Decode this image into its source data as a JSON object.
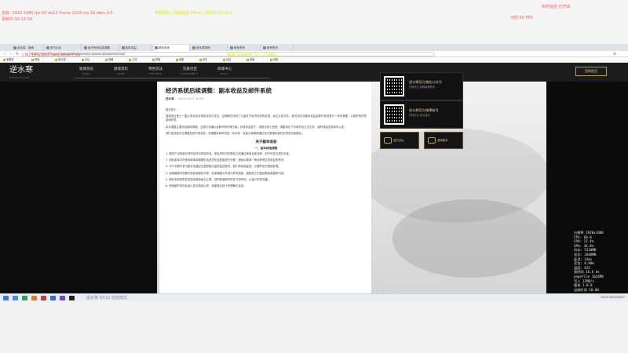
{
  "overlay_top": {
    "line1": "坐标: 1920 1080 fps 60 dx12 frame 1024 ms 16 data 0.0",
    "line2": "卡顿检测 | 网络延迟 24ms | 帧时间 16.6ms",
    "line3": "录制中 00:12:34",
    "line4": "CPU 12% GPU 34% MEM 5.2G",
    "line5": "缓存 2048MB  写入 12MB/s",
    "right1": "实时监控 已开启",
    "right2": "当前 60 FPS"
  },
  "browser": {
    "tabs": [
      {
        "title": "逆水寒 - 新闻"
      },
      {
        "title": "官方论坛"
      },
      {
        "title": "经济系统后续调整"
      },
      {
        "title": "副本收益"
      },
      {
        "title": "邮件系统"
      },
      {
        "title": "逆水寒官网"
      },
      {
        "title": "新标签页"
      },
      {
        "title": "新标签页"
      }
    ],
    "url": "https://nsh.163.com/news/update/economy-system-adjustment.html",
    "bookmarks": [
      "收藏夹",
      "网易",
      "逆水寒",
      "论坛",
      "攻略",
      "工具",
      "视频",
      "地图",
      "资讯",
      "社区",
      "商城",
      "设置"
    ]
  },
  "site": {
    "logo_text": "逆水寒",
    "logo_sub": "NISHUIHAN",
    "nav": [
      {
        "zh": "新闻资讯",
        "en": "NEWS"
      },
      {
        "zh": "游戏资料",
        "en": "GAME"
      },
      {
        "zh": "特色玩法",
        "en": "FEATURE"
      },
      {
        "zh": "玩家社区",
        "en": "COMMUNITY"
      },
      {
        "zh": "商城中心",
        "en": "MALL"
      }
    ],
    "official_button": "官网首页"
  },
  "article": {
    "title": "经济系统后续调整：副本收益及邮件系统",
    "author": "逆水寒",
    "date": "2023-10-27 10:00",
    "paragraphs": [
      "各位侠士：",
      "感谢各位侠士一直以来对逆水寒的支持与关注。近期我们收到了大量关于经济系统的反馈，经过认真讨论，我们决定对副本收益及邮件系统进行一系列调整，以维护良好的游戏环境。",
      "本次调整主要涉及副本掉落、交易行流通以及邮件附件等方面，具体内容如下，请各位侠士知悉。调整将在下次维护后正式生效，届时请留意游戏内公告。",
      "我们会持续关注调整后的市场变化，并根据实际情况进一步优化，欢迎大家继续通过官方渠道向我们反馈意见和建议。"
    ],
    "section_title": "关于副本收益",
    "section_sub": "一、副本掉落调整",
    "section_paragraphs": [
      "1. 副本产出的部分材料将改为绑定状态，绑定材料可在角色之间通过家族仓库流转，但不可在交易行出售。",
      "2. 团队副本中的首领掉落将根据队伍成员的活跃度进行分配，避免出现单一角色获得过多收益的情况。",
      "3. 对于长期不参与副本但通过交易获取大量收益的账号，我们将加强监测，必要时进行限制处理。",
      "4. 高难度副本的额外奖励将保持不变，并新增部分外观与称号奖励，鼓励侠士们挑战更高难度的内容。",
      "5. 邮件系统的附件发送将增加每日上限，同时新增邮件附件冷却时间，以减少异常流通。",
      "6. 其他细节将在后续公告中陆续公布，感谢各位侠士的理解与支持。"
    ]
  },
  "promos": {
    "card1_title": "逆水寒官方微信公众号",
    "card1_desc": "扫码关注 获取最新资讯",
    "card2_title": "逆水寒官方微博账号",
    "card2_desc": "扫码关注 参与活动",
    "mini1": "官方论坛",
    "mini2": "游戏助手"
  },
  "stats": [
    "分辨率 1920x1080",
    "FPS: 60.0",
    "CPU: 12.4%",
    "GPU: 34.8%",
    "内存: 5218MB",
    "显存: 2048MB",
    "延迟: 24ms",
    "丢包: 0.00%",
    "温度: 62C",
    "帧时间 16.6 ms",
    "pagefile 1024MB",
    "写入 12MB/s",
    "版本 1.0.0",
    "当前时间 10:00"
  ],
  "taskbar": {
    "caption": "逆水寒 DX12 动态模式",
    "tray": "10:00 2023/10/27"
  }
}
